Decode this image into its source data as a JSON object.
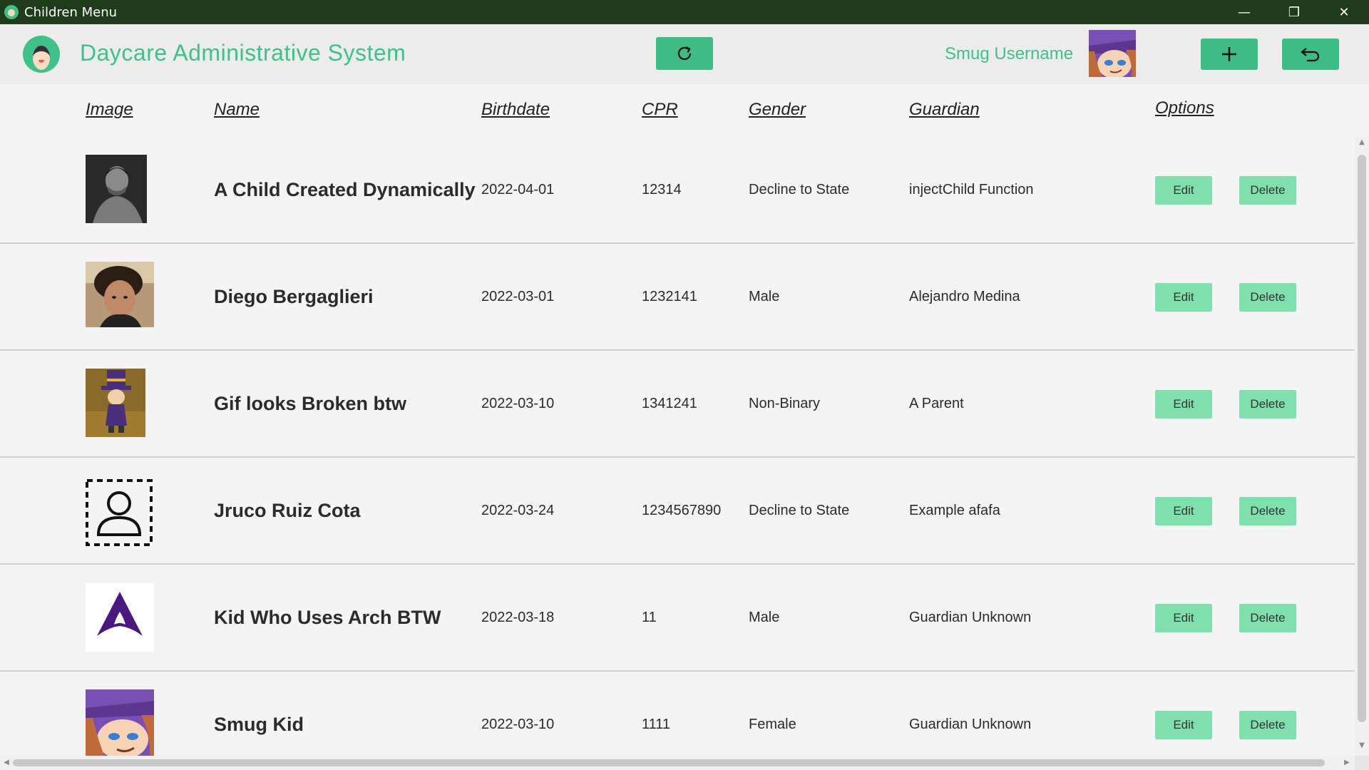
{
  "window": {
    "title": "Children Menu",
    "minimize_glyph": "—",
    "restore_glyph": "❐",
    "close_glyph": "✕"
  },
  "header": {
    "app_title": "Daycare Administrative System",
    "username": "Smug Username",
    "logo_icon": "daycare-logo-icon",
    "refresh_icon": "refresh-icon",
    "add_icon": "plus-icon",
    "back_icon": "undo-arrow-icon"
  },
  "columns": {
    "image": "Image",
    "name": "Name",
    "birthdate": "Birthdate",
    "cpr": "CPR",
    "gender": "Gender",
    "guardian": "Guardian",
    "options": "Options"
  },
  "actions": {
    "edit": "Edit",
    "delete": "Delete"
  },
  "children": [
    {
      "name": "A Child Created Dynamically",
      "birthdate": "2022-04-01",
      "cpr": "12314",
      "gender": "Decline to State",
      "guardian": "injectChild Function",
      "image": "grayscale-photo"
    },
    {
      "name": "Diego Bergaglieri",
      "birthdate": "2022-03-01",
      "cpr": "1232141",
      "gender": "Male",
      "guardian": "Alejandro Medina",
      "image": "person-photo"
    },
    {
      "name": "Gif looks Broken btw",
      "birthdate": "2022-03-10",
      "cpr": "1341241",
      "gender": "Non-Binary",
      "guardian": "A Parent",
      "image": "cartoon-hat-kid"
    },
    {
      "name": "Jruco Ruiz Cota",
      "birthdate": "2022-03-24",
      "cpr": "1234567890",
      "gender": "Decline to State",
      "guardian": "Example afafa",
      "image": "placeholder-user-icon"
    },
    {
      "name": "Kid Who Uses Arch BTW",
      "birthdate": "2022-03-18",
      "cpr": "11",
      "gender": "Male",
      "guardian": "Guardian Unknown",
      "image": "arch-logo-icon"
    },
    {
      "name": "Smug Kid",
      "birthdate": "2022-03-10",
      "cpr": "1111",
      "gender": "Female",
      "guardian": "Guardian Unknown",
      "image": "smug-cartoon"
    }
  ],
  "colors": {
    "accent": "#40c08b",
    "button": "#3dbd85",
    "action_button": "#7fe0ad",
    "titlebar": "#1e3b1a"
  }
}
